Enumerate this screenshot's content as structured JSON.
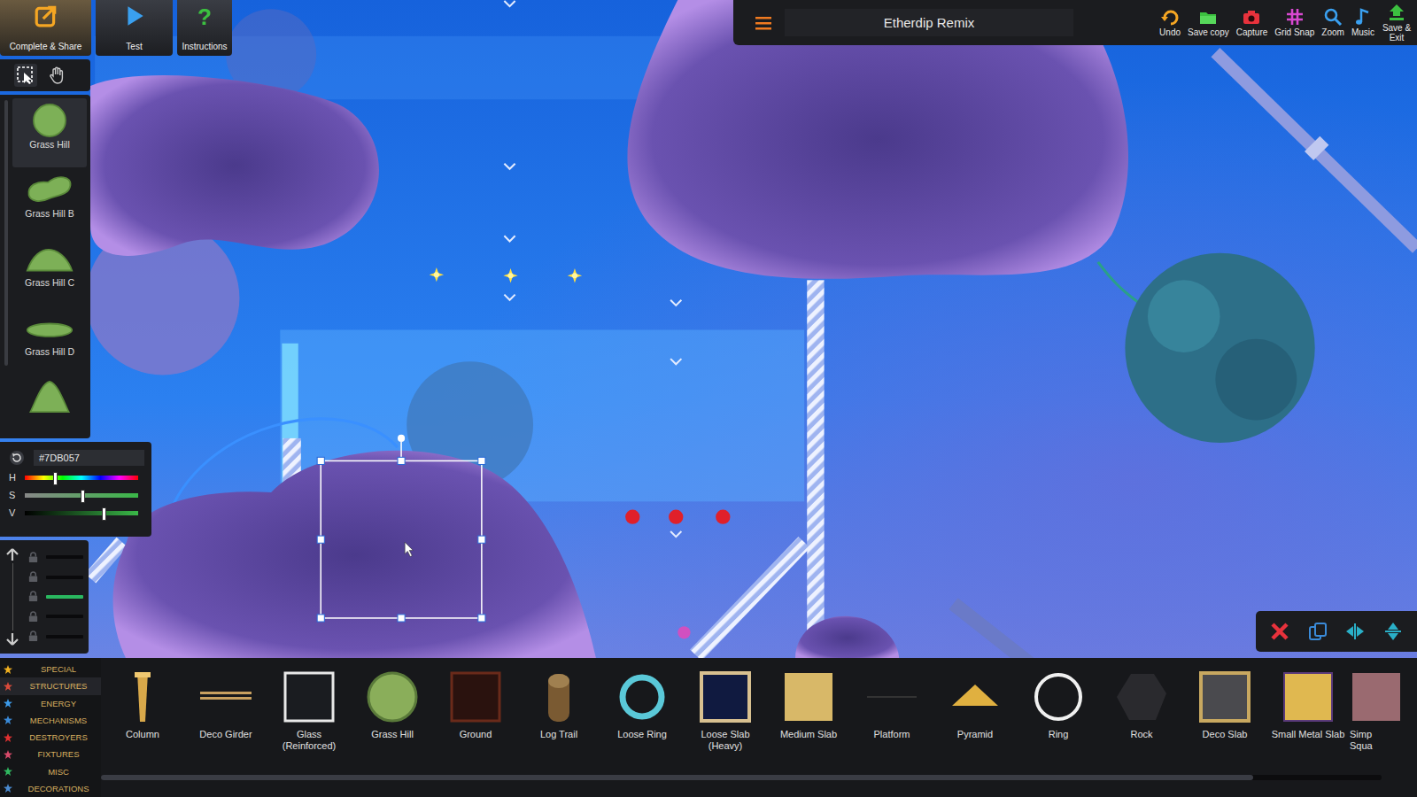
{
  "project": {
    "title": "Etherdip Remix"
  },
  "top_buttons": [
    {
      "label": "Complete & Share",
      "kind": "share",
      "glyph": ""
    },
    {
      "label": "Test",
      "kind": "test",
      "glyph": ""
    },
    {
      "label": "Instructions",
      "kind": "help",
      "glyph": "?"
    }
  ],
  "tools": [
    {
      "kind": "select",
      "selected": true
    },
    {
      "kind": "hand",
      "selected": false
    }
  ],
  "palette": {
    "items": [
      {
        "label": "Grass Hill",
        "kind": "round",
        "selected": true
      },
      {
        "label": "Grass Hill B",
        "kind": "blob",
        "selected": false
      },
      {
        "label": "Grass Hill C",
        "kind": "dome",
        "selected": false
      },
      {
        "label": "Grass Hill D",
        "kind": "flat",
        "selected": false
      },
      {
        "label": "",
        "kind": "peak",
        "selected": false
      }
    ]
  },
  "color_picker": {
    "hex": "#7DB057",
    "sliders": [
      {
        "label": "H",
        "kind": "hue",
        "level": 0.26
      },
      {
        "label": "S",
        "kind": "sat",
        "level": 0.5
      },
      {
        "label": "V",
        "kind": "val",
        "level": 0.69
      }
    ]
  },
  "layers": [
    {
      "selected": false
    },
    {
      "selected": false
    },
    {
      "selected": true
    },
    {
      "selected": false
    },
    {
      "selected": false
    }
  ],
  "toolbar": [
    {
      "label": "Undo",
      "kind": "undo"
    },
    {
      "label": "Save copy",
      "kind": "savecopy"
    },
    {
      "label": "Capture",
      "kind": "capture"
    },
    {
      "label": "Grid Snap",
      "kind": "grid"
    },
    {
      "label": "Zoom",
      "kind": "zoom"
    },
    {
      "label": "Music",
      "kind": "music"
    },
    {
      "label": "Save & Exit",
      "kind": "saveexit"
    }
  ],
  "categories": [
    {
      "label": "SPECIAL",
      "color": "#f0b020",
      "selected": false
    },
    {
      "label": "STRUCTURES",
      "color": "#d84a3a",
      "selected": true
    },
    {
      "label": "ENERGY",
      "color": "#3c9ae8",
      "selected": false
    },
    {
      "label": "MECHANISMS",
      "color": "#3a8ad8",
      "selected": false
    },
    {
      "label": "DESTROYERS",
      "color": "#e03030",
      "selected": false
    },
    {
      "label": "FIXTURES",
      "color": "#d84a6a",
      "selected": false
    },
    {
      "label": "MISC",
      "color": "#30b860",
      "selected": false
    },
    {
      "label": "DECORATIONS",
      "color": "#4a8ad0",
      "selected": false
    }
  ],
  "parts": [
    {
      "label": "Column",
      "kind": "column"
    },
    {
      "label": "Deco Girder",
      "kind": "girder"
    },
    {
      "label": "Glass (Reinforced)",
      "kind": "glass"
    },
    {
      "label": "Grass Hill",
      "kind": "grasshill"
    },
    {
      "label": "Ground",
      "kind": "ground"
    },
    {
      "label": "Log Trail",
      "kind": "log"
    },
    {
      "label": "Loose Ring",
      "kind": "loosering"
    },
    {
      "label": "Loose Slab (Heavy)",
      "kind": "looseslab"
    },
    {
      "label": "Medium Slab",
      "kind": "mediumslab"
    },
    {
      "label": "Platform",
      "kind": "platform"
    },
    {
      "label": "Pyramid",
      "kind": "pyramid"
    },
    {
      "label": "Ring",
      "kind": "ring"
    },
    {
      "label": "Rock",
      "kind": "rock"
    },
    {
      "label": "Deco Slab",
      "kind": "decoslab"
    },
    {
      "label": "Small Metal Slab",
      "kind": "smallmetal"
    },
    {
      "label": "Simp Squa",
      "kind": "simplesquare"
    }
  ],
  "parts_scroll": {
    "level": 0.9
  },
  "selection_actions": [
    {
      "kind": "delete"
    },
    {
      "kind": "duplicate"
    },
    {
      "kind": "fliph"
    },
    {
      "kind": "flipv"
    }
  ]
}
